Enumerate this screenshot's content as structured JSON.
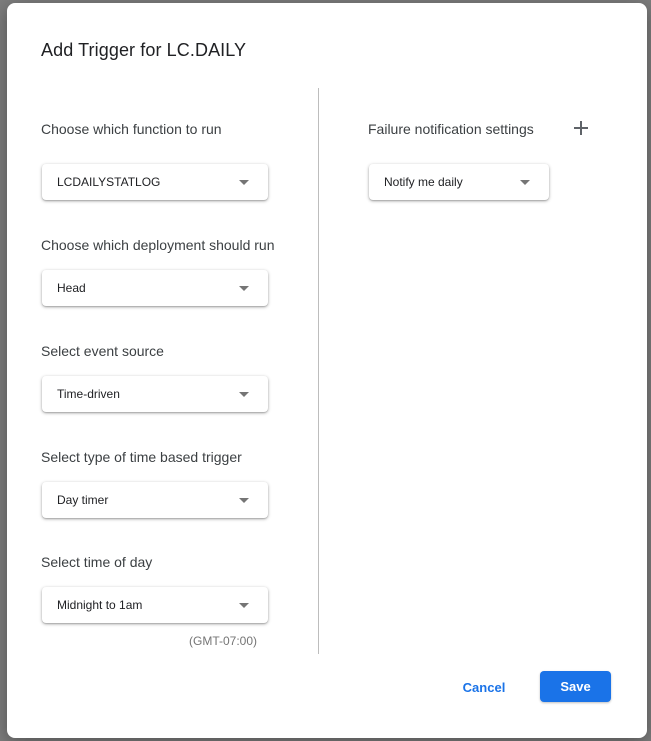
{
  "dialog": {
    "title": "Add Trigger for LC.DAILY"
  },
  "left": {
    "function": {
      "label": "Choose which function to run",
      "value": "LCDAILYSTATLOG"
    },
    "deployment": {
      "label": "Choose which deployment should run",
      "value": "Head"
    },
    "event_source": {
      "label": "Select event source",
      "value": "Time-driven"
    },
    "trigger_type": {
      "label": "Select type of time based trigger",
      "value": "Day timer"
    },
    "time_of_day": {
      "label": "Select time of day",
      "value": "Midnight to 1am",
      "timezone": "(GMT-07:00)"
    }
  },
  "right": {
    "failure_label": "Failure notification settings",
    "failure_value": "Notify me daily"
  },
  "actions": {
    "cancel": "Cancel",
    "save": "Save"
  },
  "colors": {
    "accent": "#1a73e8"
  }
}
